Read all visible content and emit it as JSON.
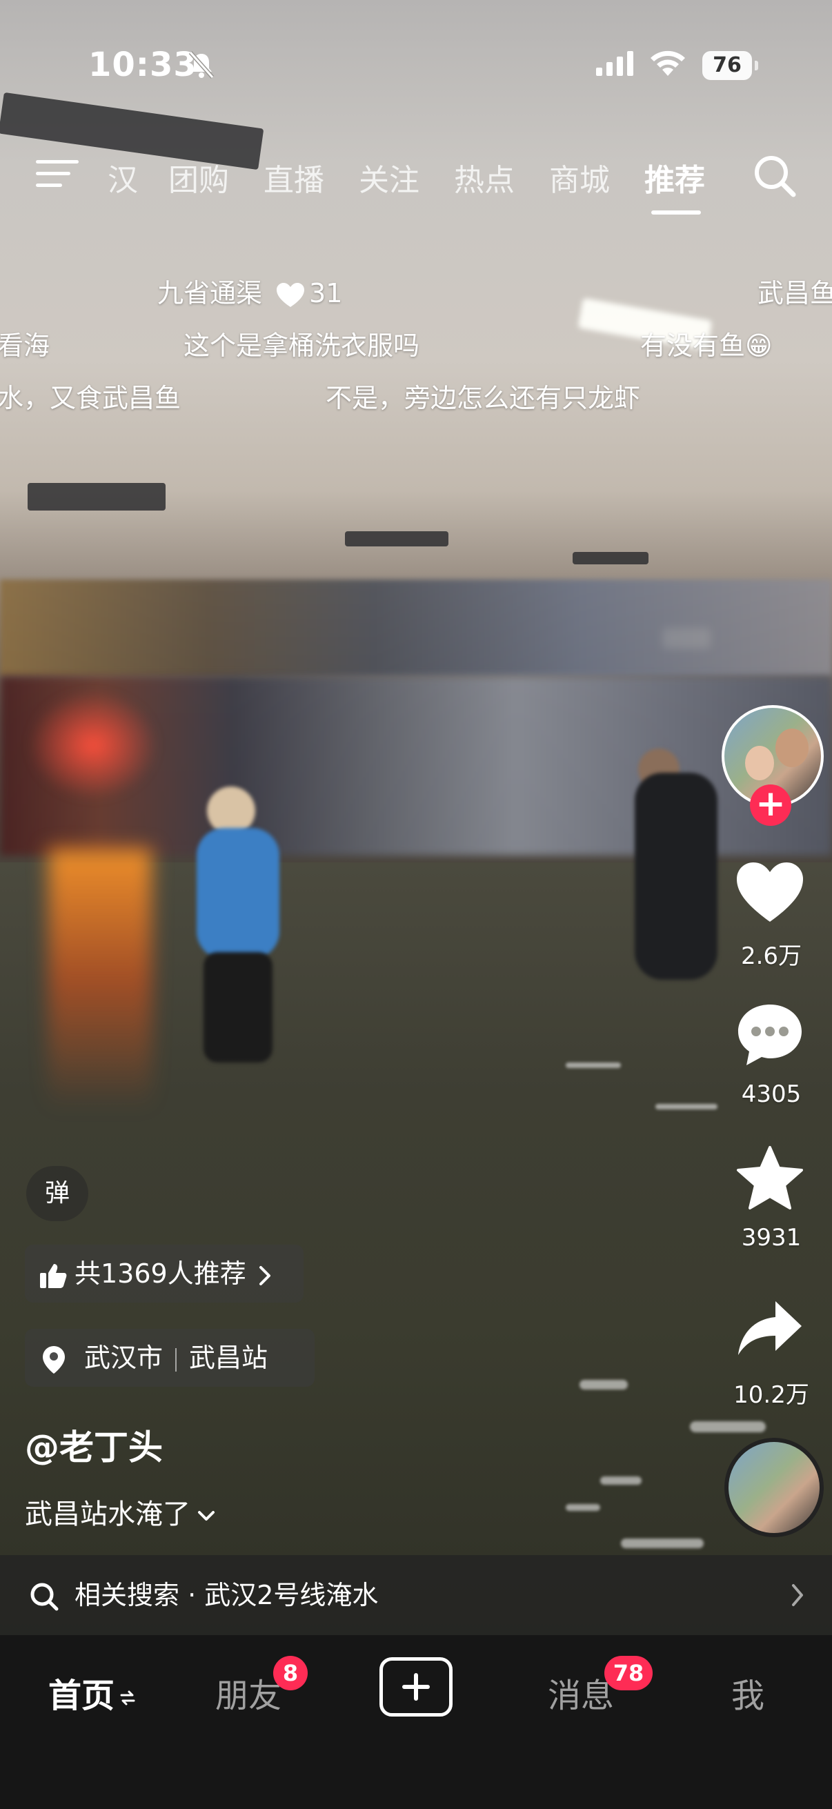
{
  "status_bar": {
    "time": "10:33",
    "battery": "76"
  },
  "top_nav": {
    "tabs": [
      "汉",
      "团购",
      "直播",
      "关注",
      "热点",
      "商城",
      "推荐"
    ],
    "active_tab": "推荐"
  },
  "danmaku": {
    "row1": [
      {
        "text": "九省通渠",
        "likes": "31"
      },
      {
        "text": "武昌鱼"
      }
    ],
    "row2": [
      "看海",
      "这个是拿桶洗衣服吗",
      "有没有鱼😁"
    ],
    "row3": [
      "水，又食武昌鱼",
      "不是，旁边怎么还有只龙虾"
    ]
  },
  "actions": {
    "likes": "2.6万",
    "comments": "4305",
    "favorites": "3931",
    "shares": "10.2万"
  },
  "danmu_toggle_label": "弹",
  "recommend_pill": "共1369人推荐",
  "location": {
    "city": "武汉市",
    "place": "武昌站"
  },
  "author": "@老丁头",
  "caption": "武昌站水淹了",
  "related_search": "相关搜索 · 武汉2号线淹水",
  "bottom_tabs": {
    "home": "首页",
    "friends": "朋友",
    "friends_badge": "8",
    "messages": "消息",
    "messages_badge": "78",
    "me": "我"
  },
  "colors": {
    "accent": "#fe2c55",
    "tabbar_bg": "#161616"
  }
}
